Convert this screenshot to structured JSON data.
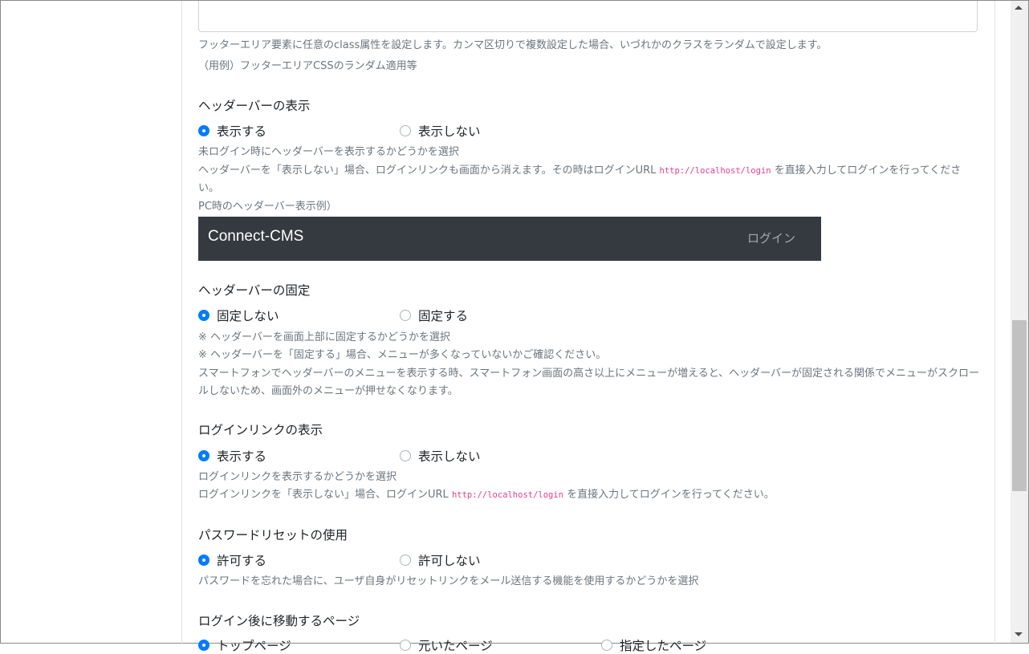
{
  "footer_class": {
    "help1": "フッターエリア要素に任意のclass属性を設定します。カンマ区切りで複数設定した場合、いづれかのクラスをランダムで設定します。",
    "help2": "（用例）フッターエリアCSSのランダム適用等"
  },
  "header_display": {
    "label": "ヘッダーバーの表示",
    "option_on": "表示する",
    "option_off": "表示しない",
    "help1": "未ログイン時にヘッダーバーを表示するかどうかを選択",
    "help2_a": "ヘッダーバーを「表示しない」場合、ログインリンクも画面から消えます。その時はログインURL ",
    "help2_code": "http://localhost/login",
    "help2_b": " を直接入力してログインを行ってください。",
    "example_caption": "PC時のヘッダーバー表示例）",
    "example_brand": "Connect-CMS",
    "example_login": "ログイン"
  },
  "header_fixed": {
    "label": "ヘッダーバーの固定",
    "option_off": "固定しない",
    "option_on": "固定する",
    "help1": "※ ヘッダーバーを画面上部に固定するかどうかを選択",
    "help2": "※ ヘッダーバーを「固定する」場合、メニューが多くなっていないかご確認ください。",
    "help3": "スマートフォンでヘッダーバーのメニューを表示する時、スマートフォン画面の高さ以上にメニューが増えると、ヘッダーバーが固定される関係でメニューがスクロールしないため、画面外のメニューが押せなくなります。"
  },
  "login_link": {
    "label": "ログインリンクの表示",
    "option_on": "表示する",
    "option_off": "表示しない",
    "help1": "ログインリンクを表示するかどうかを選択",
    "help2_a": "ログインリンクを「表示しない」場合、ログインURL ",
    "help2_code": "http://localhost/login",
    "help2_b": " を直接入力してログインを行ってください。"
  },
  "password_reset": {
    "label": "パスワードリセットの使用",
    "option_on": "許可する",
    "option_off": "許可しない",
    "help1": "パスワードを忘れた場合に、ユーザ自身がリセットリンクをメール送信する機能を使用するかどうかを選択"
  },
  "after_login": {
    "label": "ログイン後に移動するページ",
    "option1": "トップページ",
    "option2": "元いたページ",
    "option3": "指定したページ"
  },
  "colors": {
    "accent": "#007bff",
    "navbar": "#343a40",
    "muted": "#6c757d",
    "code": "#e83e8c"
  }
}
